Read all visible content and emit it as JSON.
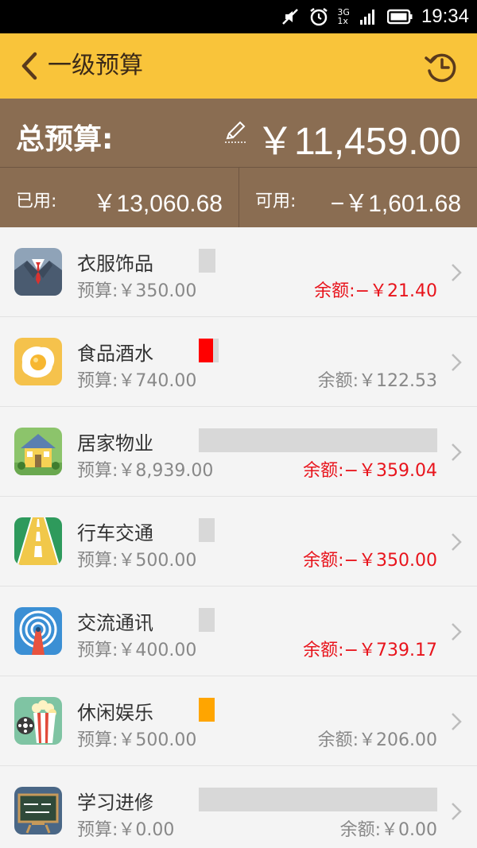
{
  "status_bar": {
    "time": "19:34",
    "network_top": "3G",
    "network_bottom": "1x",
    "icons": [
      "mute-icon",
      "alarm-icon",
      "signal-icon",
      "battery-icon"
    ]
  },
  "header": {
    "title": "一级预算",
    "back_icon": "chevron-left-icon",
    "action_icon": "history-icon",
    "bg_color": "#f9c43a"
  },
  "summary": {
    "total_label": "总预算:",
    "total_value": "￥11,459.00",
    "used_label": "已用:",
    "used_value": "￥13,060.68",
    "available_label": "可用:",
    "available_value": "−￥1,601.68",
    "bg_color": "#8a6d52"
  },
  "categories": [
    {
      "name": "衣服饰品",
      "budget": "预算:￥350.00",
      "remain": "余额:−￥21.40",
      "negative": true,
      "icon": "suit-icon",
      "bar_track": 0.07,
      "bar_fill": 0,
      "bar_color": "#d8d8d8"
    },
    {
      "name": "食品酒水",
      "budget": "预算:￥740.00",
      "remain": "余额:￥122.53",
      "negative": false,
      "icon": "fried-egg-icon",
      "bar_track": 0.083,
      "bar_fill": 0.06,
      "bar_color": "#ff0000"
    },
    {
      "name": "居家物业",
      "budget": "预算:￥8,939.00",
      "remain": "余额:−￥359.04",
      "negative": true,
      "icon": "house-icon",
      "bar_track": 1.0,
      "bar_fill": 0,
      "bar_color": "#d8d8d8"
    },
    {
      "name": "行车交通",
      "budget": "预算:￥500.00",
      "remain": "余额:−￥350.00",
      "negative": true,
      "icon": "road-icon",
      "bar_track": 0.067,
      "bar_fill": 0,
      "bar_color": "#d8d8d8"
    },
    {
      "name": "交流通讯",
      "budget": "预算:￥400.00",
      "remain": "余额:−￥739.17",
      "negative": true,
      "icon": "signal-tower-icon",
      "bar_track": 0.067,
      "bar_fill": 0,
      "bar_color": "#d8d8d8"
    },
    {
      "name": "休闲娱乐",
      "budget": "预算:￥500.00",
      "remain": "余额:￥206.00",
      "negative": false,
      "icon": "popcorn-icon",
      "bar_track": 0.067,
      "bar_fill": 0.067,
      "bar_color": "#ffa500"
    },
    {
      "name": "学习进修",
      "budget": "预算:￥0.00",
      "remain": "余额:￥0.00",
      "negative": false,
      "icon": "blackboard-icon",
      "bar_track": 1.0,
      "bar_fill": 0,
      "bar_color": "#d8d8d8"
    }
  ],
  "colors": {
    "negative": "#e8141c",
    "muted": "#888888"
  }
}
